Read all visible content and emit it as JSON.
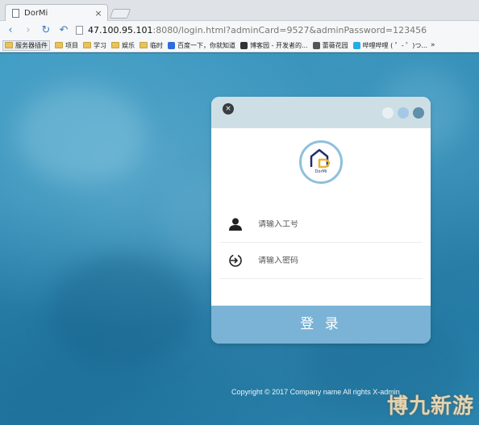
{
  "browser": {
    "tab_title": "DorMi",
    "tab_close": "×",
    "url_host": "47.100.95.101",
    "url_rest": ":8080/login.html?adminCard=9527&adminPassword=123456",
    "nav": {
      "back": "‹",
      "forward": "›",
      "reload": "↻",
      "undo": "↶"
    },
    "bookmarks": [
      {
        "label": "服务器插件",
        "kind": "folder"
      },
      {
        "label": "项目",
        "kind": "folder"
      },
      {
        "label": "学习",
        "kind": "folder"
      },
      {
        "label": "娱乐",
        "kind": "folder"
      },
      {
        "label": "临时",
        "kind": "folder"
      },
      {
        "label": "百度一下，你就知道",
        "kind": "site",
        "color": "#2d6be0"
      },
      {
        "label": "博客园 - 开发者的...",
        "kind": "site",
        "color": "#333333"
      },
      {
        "label": "蕾薇花园",
        "kind": "site",
        "color": "#555555"
      },
      {
        "label": "哔哩哔哩 ( ゜- ゜)つ...",
        "kind": "site",
        "color": "#23ade5"
      }
    ],
    "bookmarks_more": "»"
  },
  "login": {
    "close_symbol": "×",
    "dot_colors": [
      "#e8f0f3",
      "#a6c8e6",
      "#5e8fab"
    ],
    "logo_text": "DorMi",
    "username_placeholder": "请输入工号",
    "password_placeholder": "请输入密码",
    "submit_label": "登 录"
  },
  "footer": {
    "copyright": "Copyright © 2017 Company name All rights X-admin"
  },
  "watermark": "博九新游"
}
